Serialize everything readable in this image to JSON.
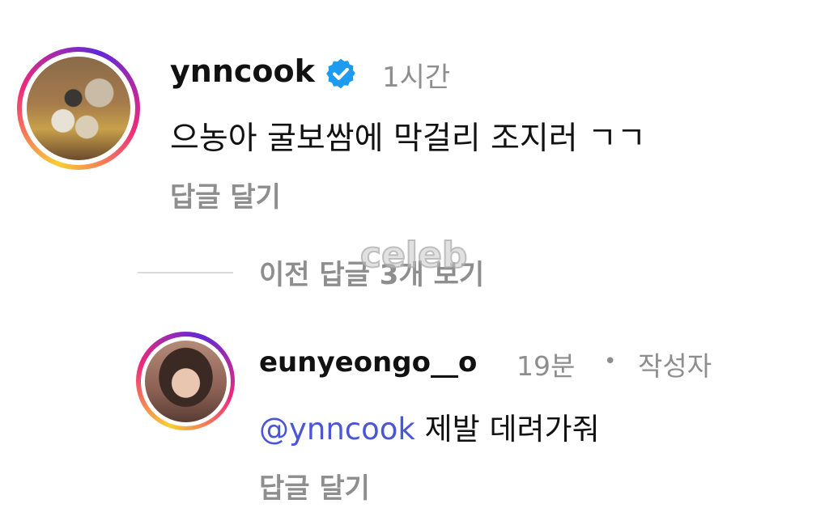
{
  "comment1": {
    "username": "ynncook",
    "avatar_icon": "profile-photo-dogs",
    "verified_icon": "verified-badge-icon",
    "time": "1시간",
    "text": "으농아 굴보쌈에 막걸리 조지러 ㄱㄱ",
    "reply_label": "답글 달기"
  },
  "view_previous_replies": "이전 답글 3개 보기",
  "comment2": {
    "username": "eunyeongo__o",
    "avatar_icon": "profile-photo-woman",
    "time": "19분",
    "separator": "•",
    "author_badge": "작성자",
    "mention": "@ynncook",
    "text": "제발 데려가줘",
    "reply_label": "답글 달기"
  },
  "watermark": "celeb",
  "colors": {
    "muted_text": "#8e8e8e",
    "mention": "#4a56d8",
    "verified": "#1d9bf0",
    "ring_start": "#f9ce34",
    "ring_mid": "#ee2a7b"
  }
}
